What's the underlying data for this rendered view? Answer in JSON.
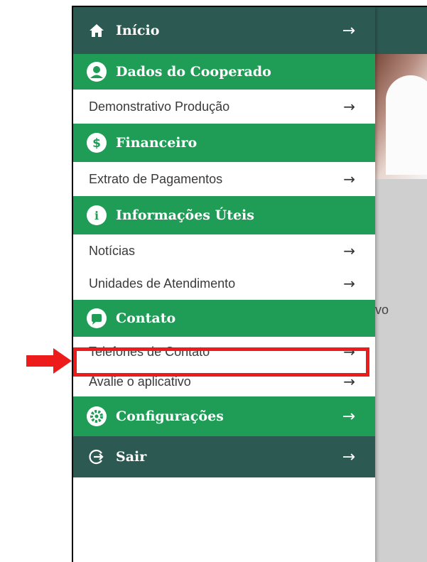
{
  "menu": {
    "inicio": "Início",
    "dados_header": "Dados do Cooperado",
    "demonstrativo": "Demonstrativo Produção",
    "financeiro_header": "Financeiro",
    "extrato": "Extrato de Pagamentos",
    "info_header": "Informações Úteis",
    "noticias": "Notícias",
    "unidades": "Unidades de Atendimento",
    "contato_header": "Contato",
    "telefones": "Telefones de Contato",
    "avalie": "Avalie o aplicativo",
    "config": "Configurações",
    "sair": "Sair"
  },
  "background": {
    "partial_text": "vo"
  },
  "icons": {
    "arrow": "arrow-right-icon",
    "inicio": "home-icon",
    "dados": "user-icon",
    "financeiro": "dollar-icon",
    "info": "info-icon",
    "contato": "chat-icon",
    "config": "gear-icon",
    "sair": "logout-icon"
  },
  "colors": {
    "dark_green": "#2c5a52",
    "green": "#1f9d57",
    "highlight": "#ee1b1b"
  }
}
